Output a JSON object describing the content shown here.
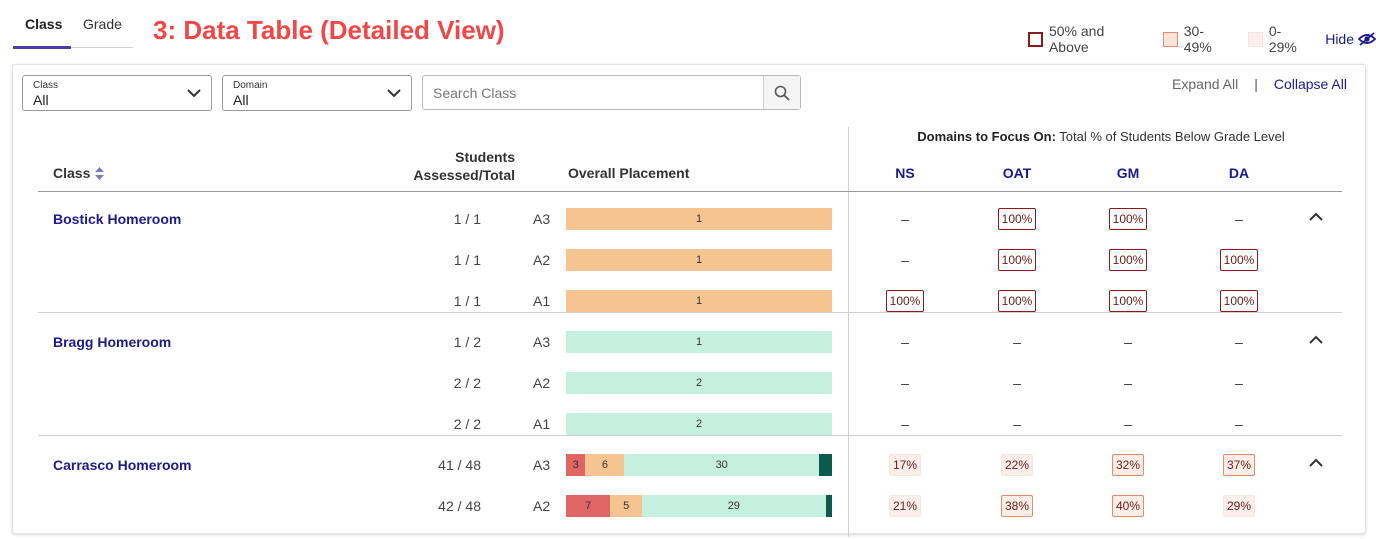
{
  "tabs": {
    "class_label": "Class",
    "grade_label": "Grade"
  },
  "page_heading": "3: Data Table (Detailed View)",
  "legend": {
    "high_label": "50% and Above",
    "mid_label": "30-49%",
    "low_label": "0-29%",
    "hide_label": "Hide",
    "colors": {
      "high": "#8b1a1a",
      "mid": "#e8896b",
      "low": "#fbeeeb"
    }
  },
  "filters": {
    "class_caption": "Class",
    "class_value": "All",
    "domain_caption": "Domain",
    "domain_value": "All",
    "search_placeholder": "Search Class"
  },
  "controls": {
    "expand_all": "Expand All",
    "separator": "|",
    "collapse_all": "Collapse All"
  },
  "table": {
    "domains_title_bold": "Domains to Focus On:",
    "domains_title_rest": " Total % of Students Below Grade Level",
    "col_class": "Class",
    "col_students_line1": "Students",
    "col_students_line2": "Assessed/Total",
    "col_placement": "Overall Placement",
    "domains": [
      "NS",
      "OAT",
      "GM",
      "DA"
    ]
  },
  "groups": [
    {
      "name": "Bostick Homeroom",
      "rows": [
        {
          "count": "1 / 1",
          "level": "A3",
          "placement": [
            {
              "color": "orange",
              "value": 1
            }
          ],
          "domains": [
            {
              "v": "–"
            },
            {
              "v": "100%",
              "t": "high"
            },
            {
              "v": "100%",
              "t": "high"
            },
            {
              "v": "–"
            }
          ]
        },
        {
          "count": "1 / 1",
          "level": "A2",
          "placement": [
            {
              "color": "orange",
              "value": 1
            }
          ],
          "domains": [
            {
              "v": "–"
            },
            {
              "v": "100%",
              "t": "high"
            },
            {
              "v": "100%",
              "t": "high"
            },
            {
              "v": "100%",
              "t": "high"
            }
          ]
        },
        {
          "count": "1 / 1",
          "level": "A1",
          "placement": [
            {
              "color": "orange",
              "value": 1
            }
          ],
          "domains": [
            {
              "v": "100%",
              "t": "high"
            },
            {
              "v": "100%",
              "t": "high"
            },
            {
              "v": "100%",
              "t": "high"
            },
            {
              "v": "100%",
              "t": "high"
            }
          ]
        }
      ]
    },
    {
      "name": "Bragg Homeroom",
      "rows": [
        {
          "count": "1 / 2",
          "level": "A3",
          "placement": [
            {
              "color": "green",
              "value": 1
            }
          ],
          "domains": [
            {
              "v": "–"
            },
            {
              "v": "–"
            },
            {
              "v": "–"
            },
            {
              "v": "–"
            }
          ]
        },
        {
          "count": "2 / 2",
          "level": "A2",
          "placement": [
            {
              "color": "green",
              "value": 2
            }
          ],
          "domains": [
            {
              "v": "–"
            },
            {
              "v": "–"
            },
            {
              "v": "–"
            },
            {
              "v": "–"
            }
          ]
        },
        {
          "count": "2 / 2",
          "level": "A1",
          "placement": [
            {
              "color": "green",
              "value": 2
            }
          ],
          "domains": [
            {
              "v": "–"
            },
            {
              "v": "–"
            },
            {
              "v": "–"
            },
            {
              "v": "–"
            }
          ]
        }
      ]
    },
    {
      "name": "Carrasco Homeroom",
      "rows": [
        {
          "count": "41 / 48",
          "level": "A3",
          "placement": [
            {
              "color": "red",
              "value": 3
            },
            {
              "color": "orange",
              "value": 6
            },
            {
              "color": "green",
              "value": 30
            },
            {
              "color": "dark",
              "value": 2
            }
          ],
          "domains": [
            {
              "v": "17%",
              "t": "low"
            },
            {
              "v": "22%",
              "t": "low"
            },
            {
              "v": "32%",
              "t": "mid"
            },
            {
              "v": "37%",
              "t": "mid"
            }
          ]
        },
        {
          "count": "42 / 48",
          "level": "A2",
          "placement": [
            {
              "color": "red",
              "value": 7
            },
            {
              "color": "orange",
              "value": 5
            },
            {
              "color": "green",
              "value": 29
            },
            {
              "color": "dark",
              "value": 1
            }
          ],
          "domains": [
            {
              "v": "21%",
              "t": "low"
            },
            {
              "v": "38%",
              "t": "mid"
            },
            {
              "v": "40%",
              "t": "mid"
            },
            {
              "v": "29%",
              "t": "low"
            }
          ]
        }
      ]
    }
  ]
}
